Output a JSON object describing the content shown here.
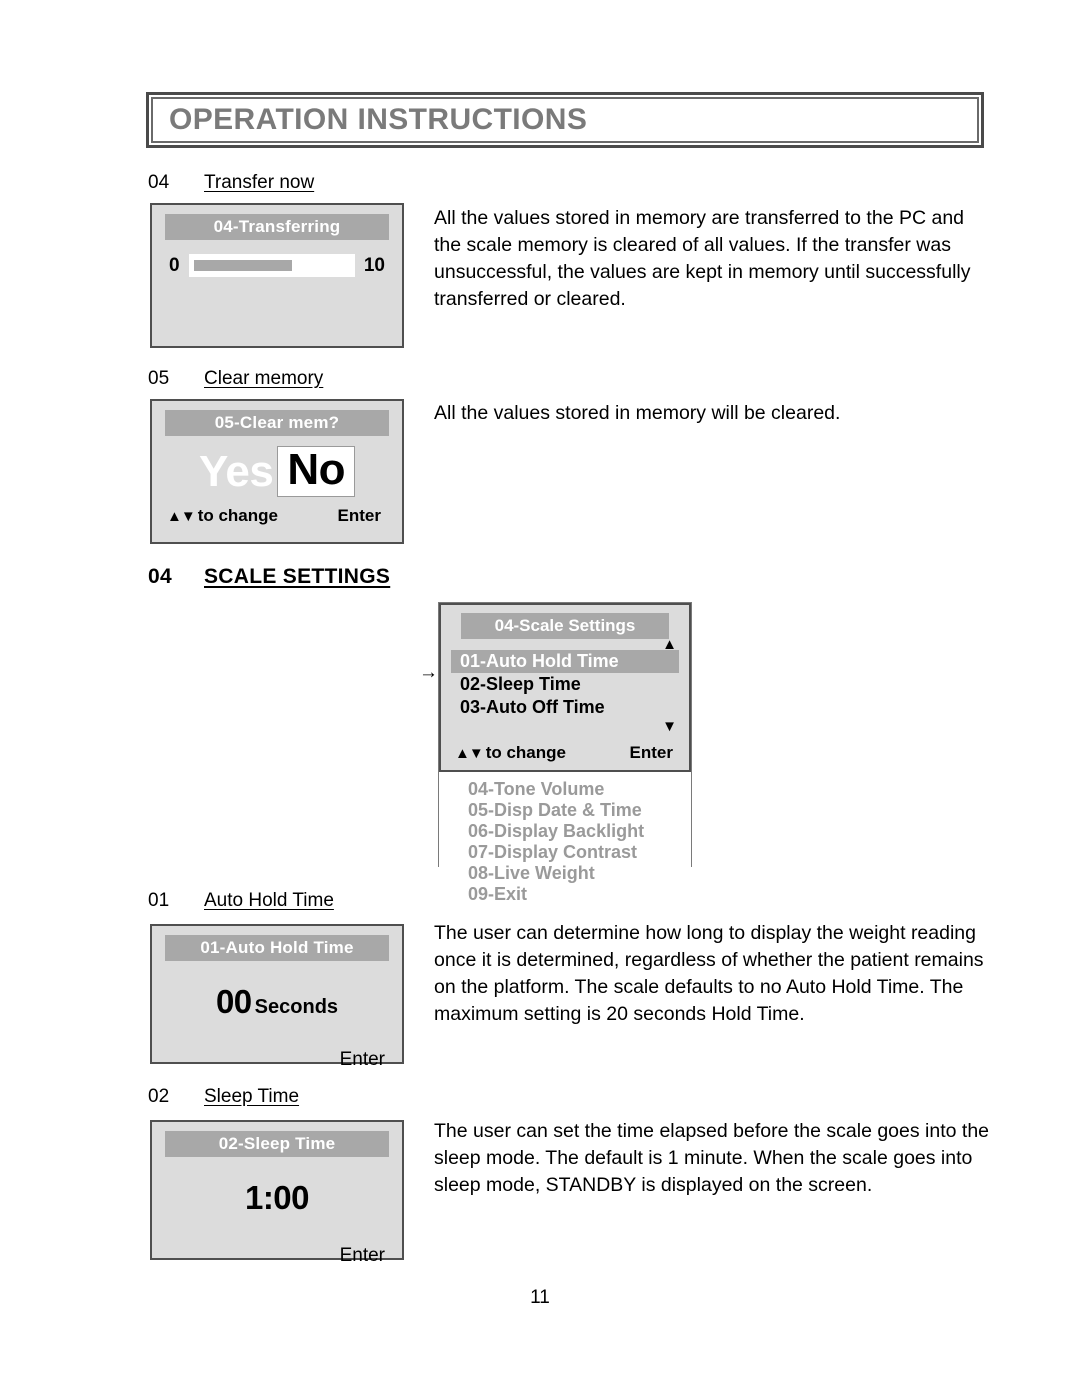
{
  "header": {
    "title": "OPERATION INSTRUCTIONS"
  },
  "sections": [
    {
      "number": "04",
      "title": "Transfer now",
      "paragraph": "All the values stored in memory are transferred to the PC and the scale memory is cleared of all values. If the transfer was unsuccessful, the values are kept in memory until successfully transferred or cleared."
    },
    {
      "number": "05",
      "title": "Clear memory",
      "paragraph": "All the values stored in memory will be cleared."
    },
    {
      "number": "04",
      "title": "SCALE SETTINGS"
    },
    {
      "number": "01",
      "title": "Auto Hold Time",
      "paragraph": "The user can determine how long to display the weight reading once it is determined, regardless of whether the patient remains on the platform. The scale defaults to no Auto Hold Time. The maximum setting is 20 seconds Hold Time."
    },
    {
      "number": "02",
      "title": "Sleep Time",
      "paragraph": "The user can set the time elapsed before the scale goes into the sleep mode. The default is 1 minute. When the scale goes into sleep mode, STANDBY is displayed on the screen."
    }
  ],
  "screens": {
    "transferring": {
      "title": "04-Transferring",
      "progress_min": "0",
      "progress_max": "10",
      "progress_percent": 63
    },
    "clear_memory": {
      "title": "05-Clear mem?",
      "option_unselected": "Yes",
      "option_selected": "No",
      "hint_arrows": "▲▼",
      "hint_change": "to change",
      "hint_enter": "Enter"
    },
    "scale_settings": {
      "title": "04-Scale Settings",
      "cursor": "→",
      "scroll_up": "▲",
      "scroll_down": "▼",
      "items_active": [
        "01-Auto Hold Time",
        "02-Sleep Time",
        "03-Auto Off Time"
      ],
      "selected_index": 0,
      "hint_arrows": "▲▼",
      "hint_change": "to change",
      "hint_enter": "Enter",
      "items_dimmed": [
        "04-Tone Volume",
        "05-Disp Date & Time",
        "06-Display Backlight",
        "07-Display Contrast",
        "08-Live Weight",
        "09-Exit"
      ]
    },
    "auto_hold_time": {
      "title": "01-Auto Hold Time",
      "value": "00",
      "unit": "Seconds",
      "enter": "Enter"
    },
    "sleep_time": {
      "title": "02-Sleep Time",
      "value": "1:00",
      "enter": "Enter"
    }
  },
  "footer": {
    "page_number": "11"
  },
  "colors": {
    "panel_bg": "#dcdcdc",
    "title_bar": "#a8a8a8",
    "dim_text": "#9a9a9a",
    "header_text": "#7a7a7a"
  }
}
